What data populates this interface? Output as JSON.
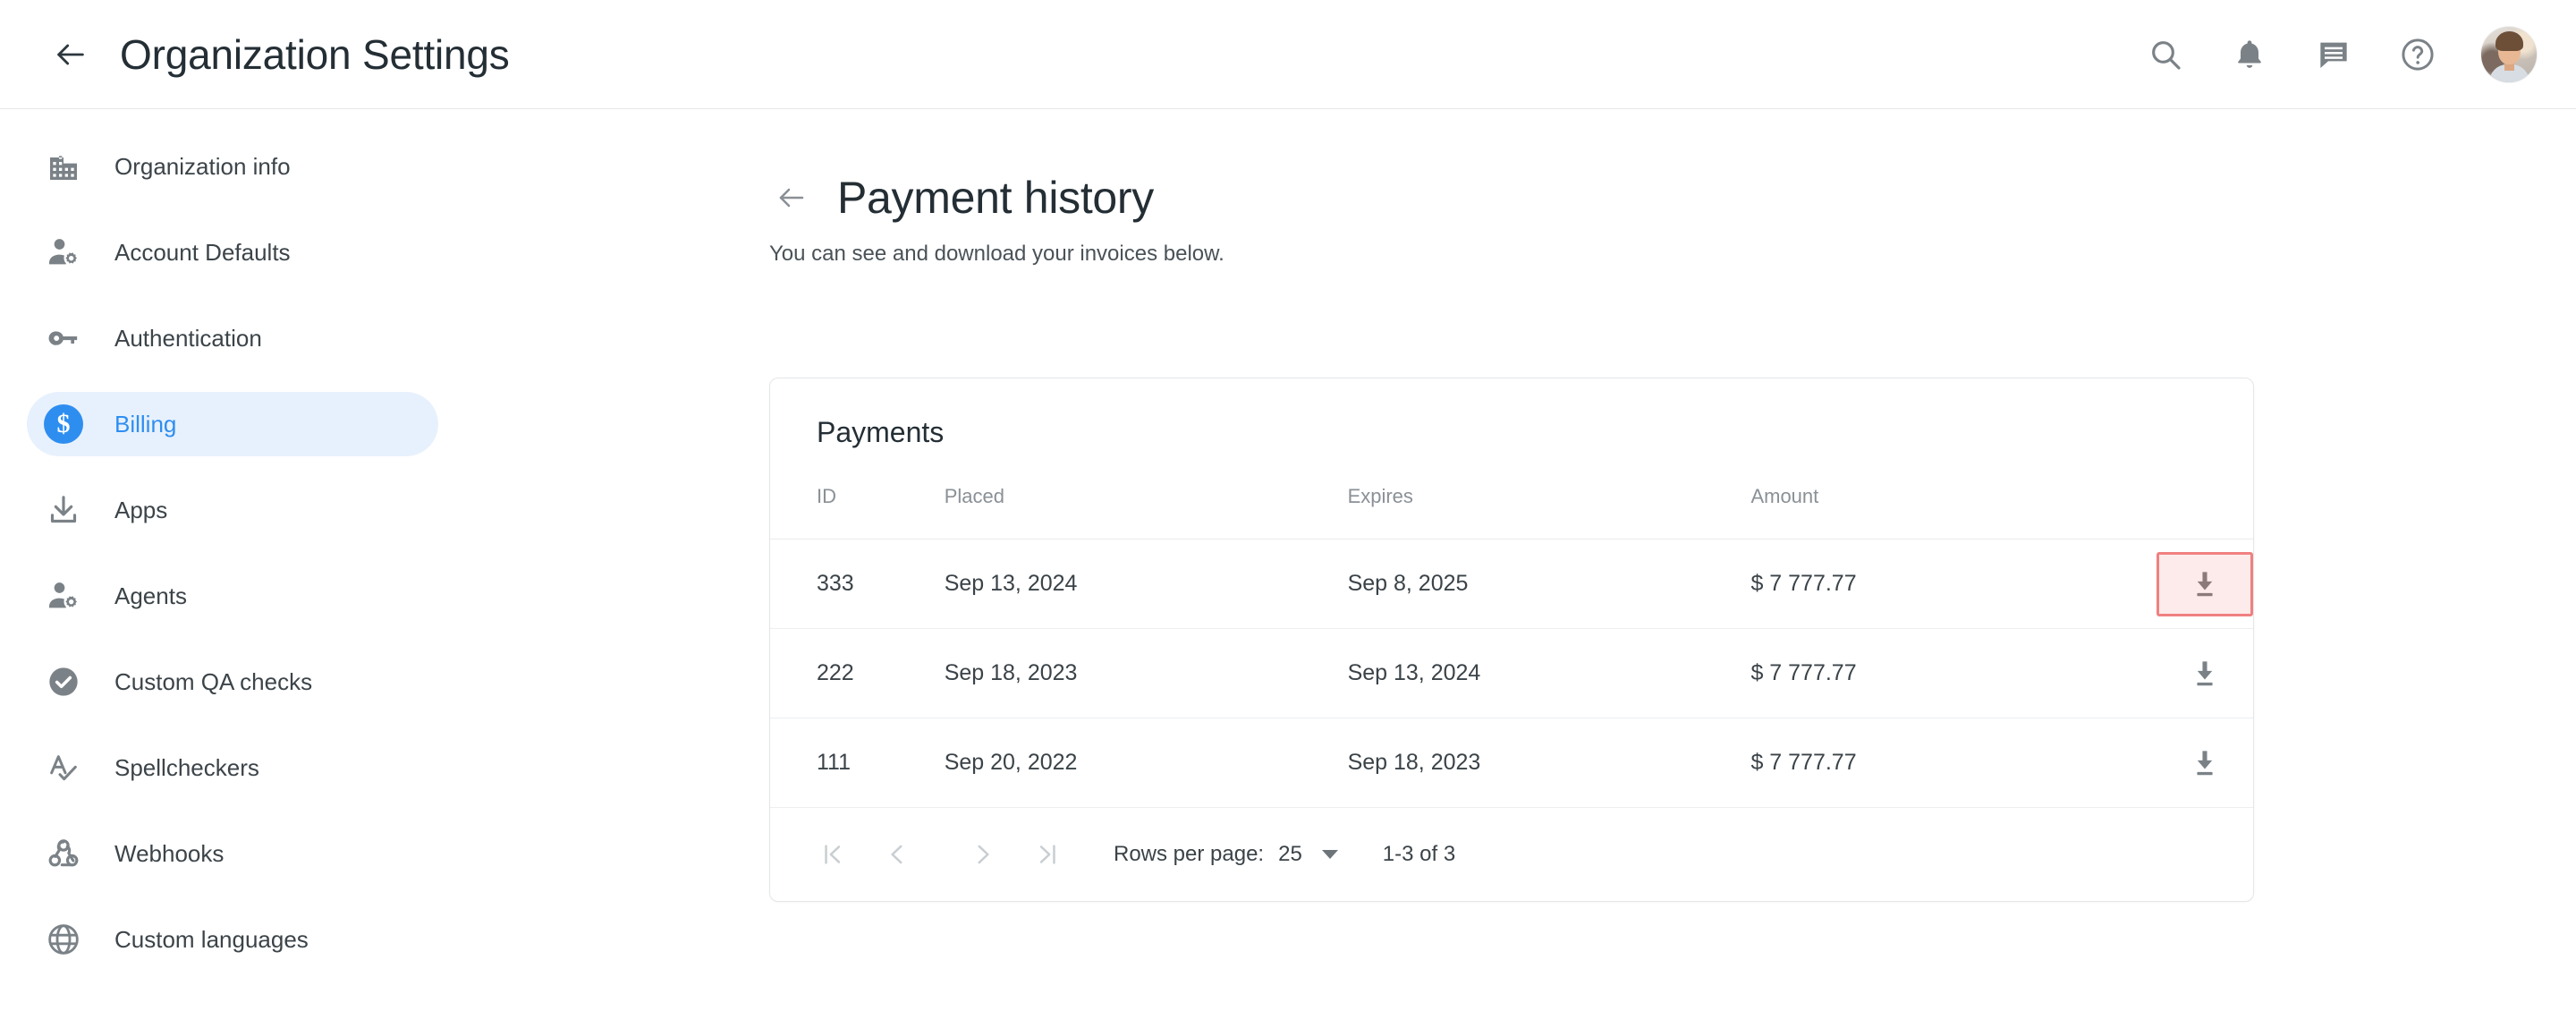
{
  "topbar": {
    "back_icon": "arrow-left-icon",
    "title": "Organization Settings",
    "actions": [
      {
        "name": "search-icon",
        "label": "Search"
      },
      {
        "name": "bell-icon",
        "label": "Notifications"
      },
      {
        "name": "chat-icon",
        "label": "Messages"
      },
      {
        "name": "help-icon",
        "label": "Help"
      }
    ],
    "avatar_label": "User avatar"
  },
  "sidebar": {
    "items": [
      {
        "label": "Organization info",
        "icon": "building-icon",
        "active": false
      },
      {
        "label": "Account Defaults",
        "icon": "person-gear-icon",
        "active": false
      },
      {
        "label": "Authentication",
        "icon": "key-icon",
        "active": false
      },
      {
        "label": "Billing",
        "icon": "dollar-circle-icon",
        "active": true
      },
      {
        "label": "Apps",
        "icon": "download-icon",
        "active": false
      },
      {
        "label": "Agents",
        "icon": "person-gear-icon",
        "active": false
      },
      {
        "label": "Custom QA checks",
        "icon": "check-circle-icon",
        "active": false
      },
      {
        "label": "Spellcheckers",
        "icon": "spellcheck-icon",
        "active": false
      },
      {
        "label": "Webhooks",
        "icon": "webhook-icon",
        "active": false
      },
      {
        "label": "Custom languages",
        "icon": "globe-icon",
        "active": false
      }
    ],
    "active_color": "#2e8ef0",
    "active_bg": "#e7f1fd"
  },
  "page": {
    "back_icon": "arrow-left-icon",
    "title": "Payment history",
    "subtitle": "You can see and download your invoices below."
  },
  "card": {
    "title": "Payments",
    "columns": [
      "ID",
      "Placed",
      "Expires",
      "Amount",
      ""
    ],
    "rows": [
      {
        "id": "333",
        "placed": "Sep 13, 2024",
        "expires": "Sep 8, 2025",
        "amount": "$ 7 777.77",
        "download_icon": "download-icon",
        "highlighted": true
      },
      {
        "id": "222",
        "placed": "Sep 18, 2023",
        "expires": "Sep 13, 2024",
        "amount": "$ 7 777.77",
        "download_icon": "download-icon",
        "highlighted": false
      },
      {
        "id": "111",
        "placed": "Sep 20, 2022",
        "expires": "Sep 18, 2023",
        "amount": "$ 7 777.77",
        "download_icon": "download-icon",
        "highlighted": false
      }
    ],
    "highlight_border_color": "#f08080",
    "highlight_fill_color": "#fdeaea"
  },
  "pagination": {
    "first_icon": "first-page-icon",
    "prev_icon": "chevron-left-icon",
    "next_icon": "chevron-right-icon",
    "last_icon": "last-page-icon",
    "rows_per_page_label": "Rows per page:",
    "rows_per_page_value": "25",
    "caret_icon": "chevron-down-icon",
    "range_label": "1-3 of 3"
  }
}
